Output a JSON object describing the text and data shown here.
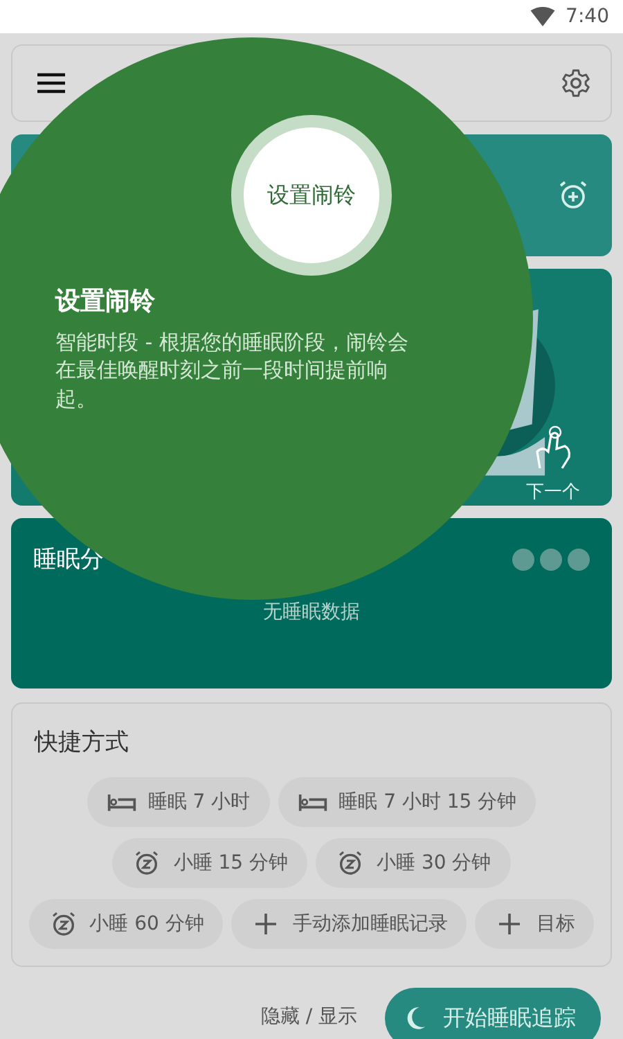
{
  "status_bar": {
    "time": "7:40"
  },
  "sleep_score": {
    "title": "睡眠分",
    "empty_text": "无睡眠数据"
  },
  "shortcuts": {
    "title": "快捷方式",
    "items": [
      {
        "kind": "bed",
        "label": "睡眠 7 小时"
      },
      {
        "kind": "bed",
        "label": "睡眠 7 小时 15 分钟"
      },
      {
        "kind": "nap",
        "label": "小睡 15 分钟"
      },
      {
        "kind": "nap",
        "label": "小睡 30 分钟"
      },
      {
        "kind": "nap",
        "label": "小睡 60 分钟"
      },
      {
        "kind": "add",
        "label": "手动添加睡眠记录"
      },
      {
        "kind": "add",
        "label": "目标"
      }
    ]
  },
  "footer": {
    "toggle": "隐藏 / 显示",
    "start_button": "开始睡眠追踪"
  },
  "tutorial": {
    "spot_label": "设置闹铃",
    "title": "设置闹铃",
    "description": "智能时段 - 根据您的睡眠阶段，闹铃会在最佳唤醒时刻之前一段时间提前响起。",
    "next": "下一个"
  }
}
